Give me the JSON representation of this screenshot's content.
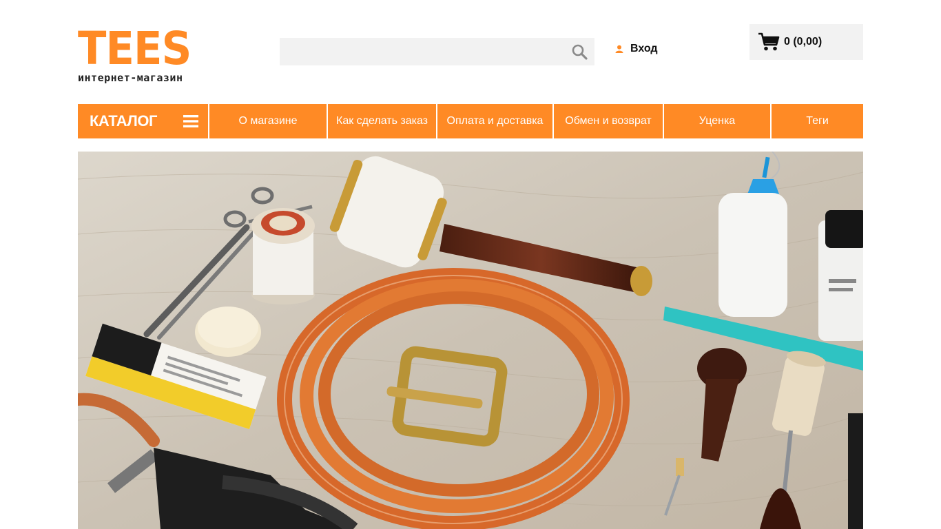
{
  "logo": {
    "title": "TEES",
    "subtitle": "интернет-магазин"
  },
  "search": {
    "value": "",
    "placeholder": "",
    "icon": "search-icon"
  },
  "login": {
    "label": "Вход",
    "icon": "user-icon"
  },
  "cart": {
    "label": "0 (0,00)",
    "icon": "cart-icon"
  },
  "nav": {
    "catalog_label": "КАТАЛОГ",
    "catalog_icon": "menu-icon",
    "items": [
      {
        "label": "О магазине"
      },
      {
        "label": "Как сделать заказ"
      },
      {
        "label": "Оплата и доставка"
      },
      {
        "label": "Обмен и возврат"
      },
      {
        "label": "Уценка"
      },
      {
        "label": "Теги"
      }
    ]
  },
  "colors": {
    "accent": "#ff8a25",
    "panel": "#f2f2f2"
  }
}
